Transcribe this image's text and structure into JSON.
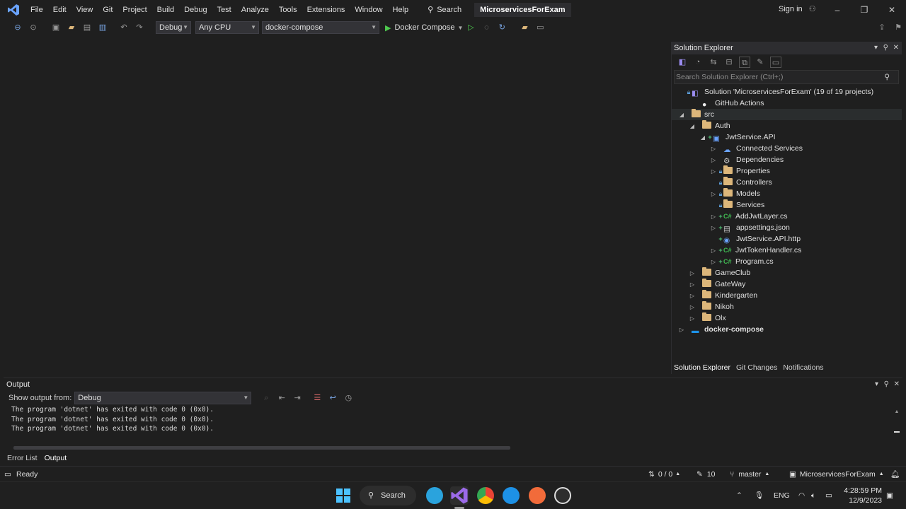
{
  "menubar": {
    "items": [
      "File",
      "Edit",
      "View",
      "Git",
      "Project",
      "Build",
      "Debug",
      "Test",
      "Analyze",
      "Tools",
      "Extensions",
      "Window",
      "Help"
    ],
    "search_label": "Search",
    "solution_name": "MicroservicesForExam",
    "signin_label": "Sign in"
  },
  "toolbar": {
    "config": "Debug",
    "platform": "Any CPU",
    "startup_project": "docker-compose",
    "run_label": "Docker Compose"
  },
  "solution_explorer": {
    "title": "Solution Explorer",
    "search_placeholder": "Search Solution Explorer (Ctrl+;)",
    "tree": [
      {
        "label": "Solution 'MicroservicesForExam' (19 of 19 projects)",
        "icon": "solution-icon",
        "level": 0,
        "expander": "",
        "badge": "lock"
      },
      {
        "label": "GitHub Actions",
        "icon": "github-icon",
        "level": 1,
        "expander": "",
        "badge": ""
      },
      {
        "label": "src",
        "icon": "folder-icon",
        "level": 0,
        "expander": "open",
        "badge": "",
        "selected": true
      },
      {
        "label": "Auth",
        "icon": "folder-icon",
        "level": 1,
        "expander": "open",
        "badge": ""
      },
      {
        "label": "JwtService.API",
        "icon": "project-icon",
        "level": 2,
        "expander": "open",
        "badge": "plus"
      },
      {
        "label": "Connected Services",
        "icon": "connected-services-icon",
        "level": 3,
        "expander": "closed",
        "badge": ""
      },
      {
        "label": "Dependencies",
        "icon": "dependencies-icon",
        "level": 3,
        "expander": "closed",
        "badge": ""
      },
      {
        "label": "Properties",
        "icon": "folder-icon",
        "level": 3,
        "expander": "closed",
        "badge": "lock"
      },
      {
        "label": "Controllers",
        "icon": "folder-icon",
        "level": 3,
        "expander": "",
        "badge": "lock"
      },
      {
        "label": "Models",
        "icon": "folder-icon",
        "level": 3,
        "expander": "closed",
        "badge": "lock"
      },
      {
        "label": "Services",
        "icon": "folder-icon",
        "level": 3,
        "expander": "",
        "badge": "lock"
      },
      {
        "label": "AddJwtLayer.cs",
        "icon": "csharp-icon",
        "level": 3,
        "expander": "closed",
        "badge": "plus"
      },
      {
        "label": "appsettings.json",
        "icon": "json-icon",
        "level": 3,
        "expander": "closed",
        "badge": "plus"
      },
      {
        "label": "JwtService.API.http",
        "icon": "http-icon",
        "level": 3,
        "expander": "",
        "badge": "plus"
      },
      {
        "label": "JwtTokenHandler.cs",
        "icon": "csharp-icon",
        "level": 3,
        "expander": "closed",
        "badge": "plus"
      },
      {
        "label": "Program.cs",
        "icon": "csharp-icon",
        "level": 3,
        "expander": "closed",
        "badge": "plus"
      },
      {
        "label": "GameClub",
        "icon": "folder-icon",
        "level": 1,
        "expander": "closed",
        "badge": ""
      },
      {
        "label": "GateWay",
        "icon": "folder-icon",
        "level": 1,
        "expander": "closed",
        "badge": ""
      },
      {
        "label": "Kindergarten",
        "icon": "folder-icon",
        "level": 1,
        "expander": "closed",
        "badge": ""
      },
      {
        "label": "Nikoh",
        "icon": "folder-icon",
        "level": 1,
        "expander": "closed",
        "badge": ""
      },
      {
        "label": "Olx",
        "icon": "folder-icon",
        "level": 1,
        "expander": "closed",
        "badge": ""
      },
      {
        "label": "docker-compose",
        "icon": "docker-icon",
        "level": 0,
        "expander": "closed",
        "badge": "",
        "bold": true
      }
    ],
    "tabs": [
      "Solution Explorer",
      "Git Changes",
      "Notifications"
    ]
  },
  "output": {
    "title": "Output",
    "show_from_label": "Show output from:",
    "source": "Debug",
    "lines": [
      "The program 'dotnet' has exited with code 0 (0x0).",
      "The program 'dotnet' has exited with code 0 (0x0).",
      "The program 'dotnet' has exited with code 0 (0x0)."
    ]
  },
  "bottom_tabs": [
    "Error List",
    "Output"
  ],
  "statusbar": {
    "status": "Ready",
    "changes": "0 / 0",
    "edits": "10",
    "branch": "master",
    "repo": "MicroservicesForExam"
  },
  "taskbar": {
    "search_label": "Search",
    "language": "ENG",
    "time": "4:28:59 PM",
    "date": "12/9/2023"
  },
  "colors": {
    "background": "#1f1f1f",
    "accent": "#7160e8",
    "folder": "#dcb67a",
    "csharp": "#3fb950"
  }
}
